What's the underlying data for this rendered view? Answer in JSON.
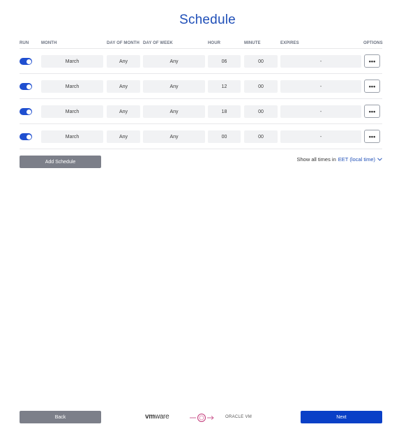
{
  "title": "Schedule",
  "columns": {
    "run": "RUN",
    "month": "MONTH",
    "day_of_month": "DAY OF MONTH",
    "day_of_week": "DAY OF WEEK",
    "hour": "HOUR",
    "minute": "MINUTE",
    "expires": "EXPIRES",
    "options": "OPTIONS"
  },
  "rows": [
    {
      "run": true,
      "month": "March",
      "day_of_month": "Any",
      "day_of_week": "Any",
      "hour": "06",
      "minute": "00",
      "expires": "-",
      "options": "•••"
    },
    {
      "run": true,
      "month": "March",
      "day_of_month": "Any",
      "day_of_week": "Any",
      "hour": "12",
      "minute": "00",
      "expires": "-",
      "options": "•••"
    },
    {
      "run": true,
      "month": "March",
      "day_of_month": "Any",
      "day_of_week": "Any",
      "hour": "18",
      "minute": "00",
      "expires": "-",
      "options": "•••"
    },
    {
      "run": true,
      "month": "March",
      "day_of_month": "Any",
      "day_of_week": "Any",
      "hour": "00",
      "minute": "00",
      "expires": "-",
      "options": "•••"
    }
  ],
  "add_schedule_label": "Add Schedule",
  "timezone": {
    "prefix": "Show all times in",
    "value": "EET (local time)"
  },
  "footer": {
    "back_label": "Back",
    "next_label": "Next",
    "vmware_logo": "vm",
    "vmware_logo_sub": "ware",
    "oracle_logo": "ORACLE VM"
  },
  "colors": {
    "accent": "#1f4fb8",
    "toggle_on": "#1f4fd0",
    "next_button": "#0a40c7",
    "secondary_button": "#7c7f89",
    "field_bg": "#f1f2f4"
  }
}
